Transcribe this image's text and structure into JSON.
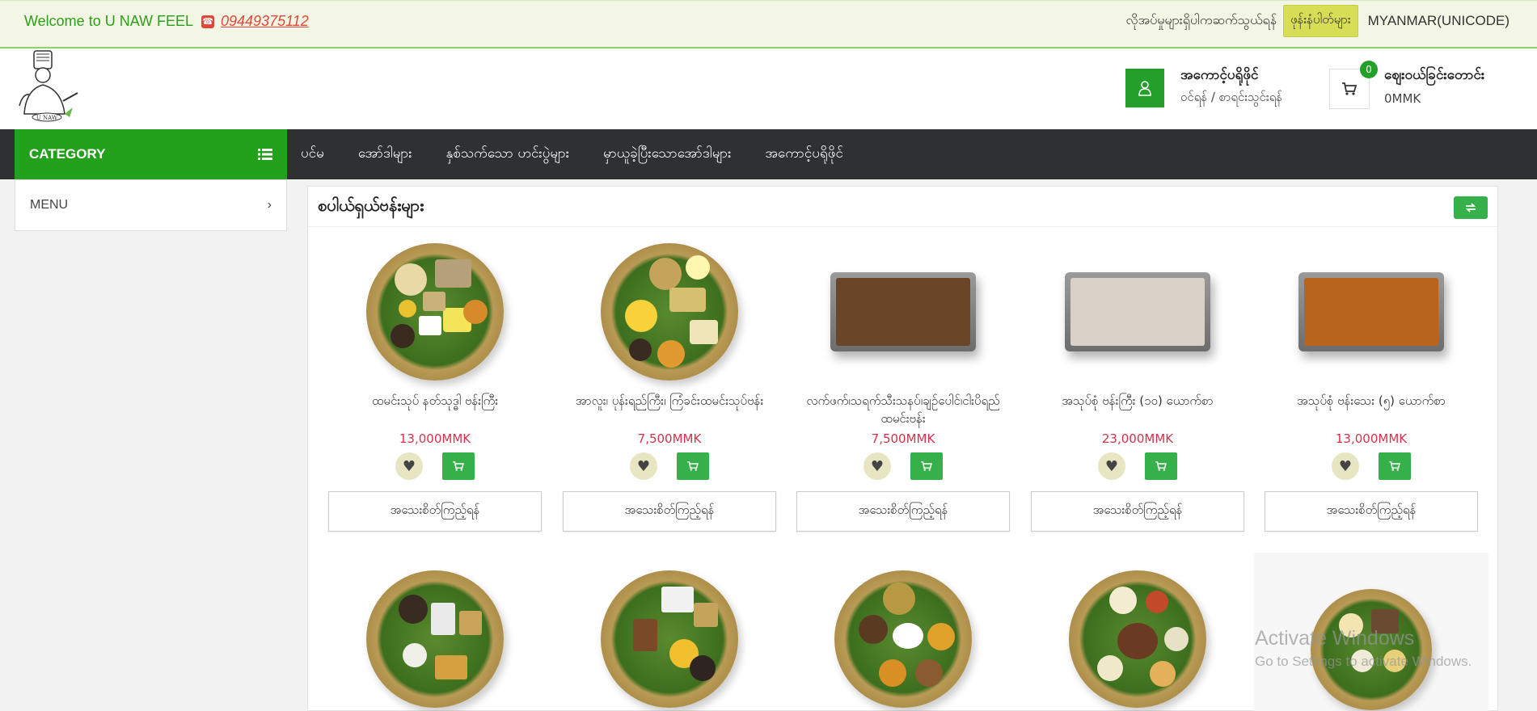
{
  "topbar": {
    "welcome": "Welcome to U NAW FEEL",
    "phone": "09449375112",
    "contact_link": "လိုအပ်မှုများရှိပါကဆက်သွယ်ရန်",
    "orders_button": "ဖုန်းနံပါတ်များ",
    "language": "MYANMAR(UNICODE)"
  },
  "header": {
    "logo_text": "U NAW",
    "account_title": "အကောင့်ပရိုဖိုင်",
    "account_sub": "ဝင်ရန် / စာရင်းသွင်းရန်",
    "cart_count": "0",
    "cart_title": "ဈေးဝယ်ခြင်းတောင်း",
    "cart_amount": "0MMK"
  },
  "nav": {
    "category_label": "CATEGORY",
    "items": [
      "ပင်မ",
      "အော်ဒါများ",
      "နှစ်သက်သော ဟင်းပွဲများ",
      "မှာယူခဲ့ပြီးသောအော်ဒါများ",
      "အကောင့်ပရိုဖိုင်"
    ]
  },
  "sidebar": {
    "menu_label": "MENU"
  },
  "main": {
    "title": "စပါယ်ရှယ်ဗန်းများ",
    "detail_label": "အသေးစိတ်ကြည့်ရန်",
    "products": [
      {
        "name": "ထမင်းသုပ် နတ်သုဒ္ဓါ ဗန်းကြီး",
        "price": "13,000MMK"
      },
      {
        "name": "အာလူး၊ ပုန်းရည်ကြီး၊ ကြံခင်းထမင်းသုပ်ဗန်း",
        "price": "7,500MMK"
      },
      {
        "name": "လက်ဖက်၊သရက်သီးသနပ်၊ချဉ်ပေါင်၊ငါးပိရည် ထမင်းဗန်း",
        "price": "7,500MMK"
      },
      {
        "name": "အသုပ်စုံ ဗန်းကြီး (၁၀) ယောက်စာ",
        "price": "23,000MMK"
      },
      {
        "name": "အသုပ်စုံ ဗန်းသေး (၅) ယောက်စာ",
        "price": "13,000MMK"
      }
    ]
  },
  "watermark": {
    "line1": "Activate Windows",
    "line2": "Go to Settings to activate Windows."
  }
}
